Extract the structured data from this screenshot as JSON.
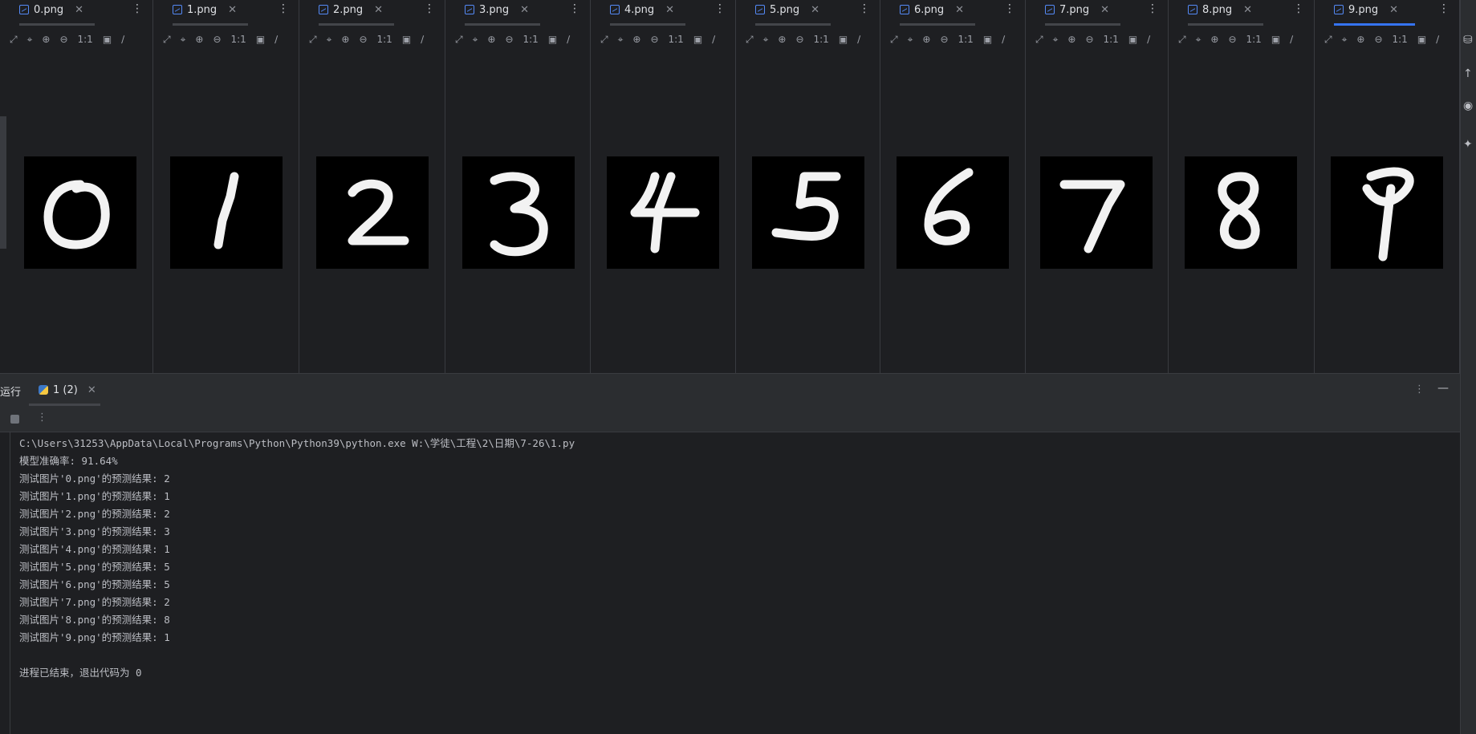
{
  "tabs": [
    {
      "label": "0.png",
      "digit": "0",
      "active": false
    },
    {
      "label": "1.png",
      "digit": "1",
      "active": false
    },
    {
      "label": "2.png",
      "digit": "2",
      "active": false
    },
    {
      "label": "3.png",
      "digit": "3",
      "active": false
    },
    {
      "label": "4.png",
      "digit": "4",
      "active": false
    },
    {
      "label": "5.png",
      "digit": "5",
      "active": false
    },
    {
      "label": "6.png",
      "digit": "6",
      "active": false
    },
    {
      "label": "7.png",
      "digit": "7",
      "active": false
    },
    {
      "label": "8.png",
      "digit": "8",
      "active": false
    },
    {
      "label": "9.png",
      "digit": "9",
      "active": true
    }
  ],
  "image_toolbar": {
    "actual_size_label": "1:1"
  },
  "run": {
    "panel_title": "运行",
    "tab_label": "1 (2)",
    "console_lines": [
      "C:\\Users\\31253\\AppData\\Local\\Programs\\Python\\Python39\\python.exe W:\\学徒\\工程\\2\\日期\\7-26\\1.py",
      "模型准确率: 91.64%",
      "测试图片'0.png'的预测结果: 2",
      "测试图片'1.png'的预测结果: 1",
      "测试图片'2.png'的预测结果: 2",
      "测试图片'3.png'的预测结果: 3",
      "测试图片'4.png'的预测结果: 1",
      "测试图片'5.png'的预测结果: 5",
      "测试图片'6.png'的预测结果: 5",
      "测试图片'7.png'的预测结果: 2",
      "测试图片'8.png'的预测结果: 8",
      "测试图片'9.png'的预测结果: 1",
      "",
      "进程已结束，退出代码为 0"
    ]
  },
  "colors": {
    "accent": "#3574f0",
    "background": "#1e1f22",
    "panel": "#2b2d30"
  }
}
